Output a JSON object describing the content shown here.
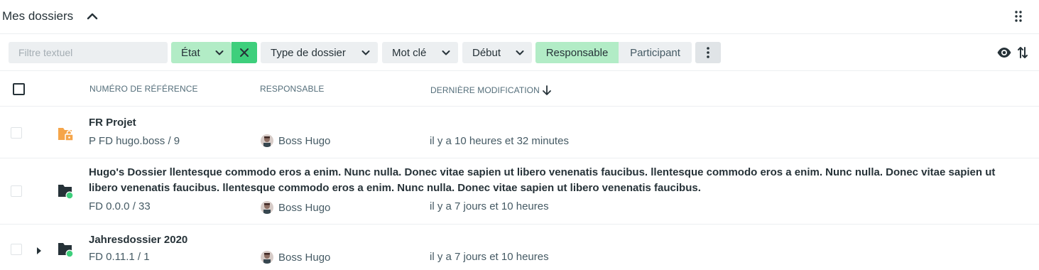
{
  "header": {
    "title": "Mes dossiers",
    "collapse_icon": "chevron-up-icon",
    "grip_icon": "drag-grip-icon"
  },
  "filters": {
    "search_placeholder": "Filtre textuel",
    "state_label": "État",
    "type_label": "Type de dossier",
    "keyword_label": "Mot clé",
    "start_label": "Début",
    "segment_responsible": "Responsable",
    "segment_participant": "Participant",
    "active_segment": "Responsable"
  },
  "table": {
    "columns": {
      "reference": "NUMÉRO DE RÉFÉRENCE",
      "responsible": "RESPONSABLE",
      "last_modified": "DERNIÈRE MODIFICATION"
    },
    "rows": [
      {
        "name": "FR Projet",
        "reference": "P FD hugo.boss / 9",
        "responsible": "Boss Hugo",
        "modified": "il y a 10 heures et 32 minutes",
        "icon": "locked-folder-icon"
      },
      {
        "name": "Hugo's Dossier llentesque commodo eros a enim. Nunc nulla. Donec vitae sapien ut libero venenatis faucibus. llentesque commodo eros a enim. Nunc nulla. Donec vitae sapien ut libero venenatis faucibus. llentesque commodo eros a enim. Nunc nulla. Donec vitae sapien ut libero venenatis faucibus.",
        "reference": "FD 0.0.0 / 33",
        "responsible": "Boss Hugo",
        "modified": "il y a 7 jours et 10 heures",
        "icon": "active-folder-icon"
      },
      {
        "name": "Jahresdossier 2020",
        "reference": "FD 0.11.1 / 1",
        "responsible": "Boss Hugo",
        "modified": "il y a 7 jours et 10 heures",
        "icon": "active-folder-icon"
      }
    ]
  },
  "colors": {
    "accent_green": "#3ecf7c",
    "active_chip": "#b2ecc6",
    "chip_bg": "#eceff1",
    "folder_orange": "#f5a54a",
    "folder_dark": "#263238"
  }
}
